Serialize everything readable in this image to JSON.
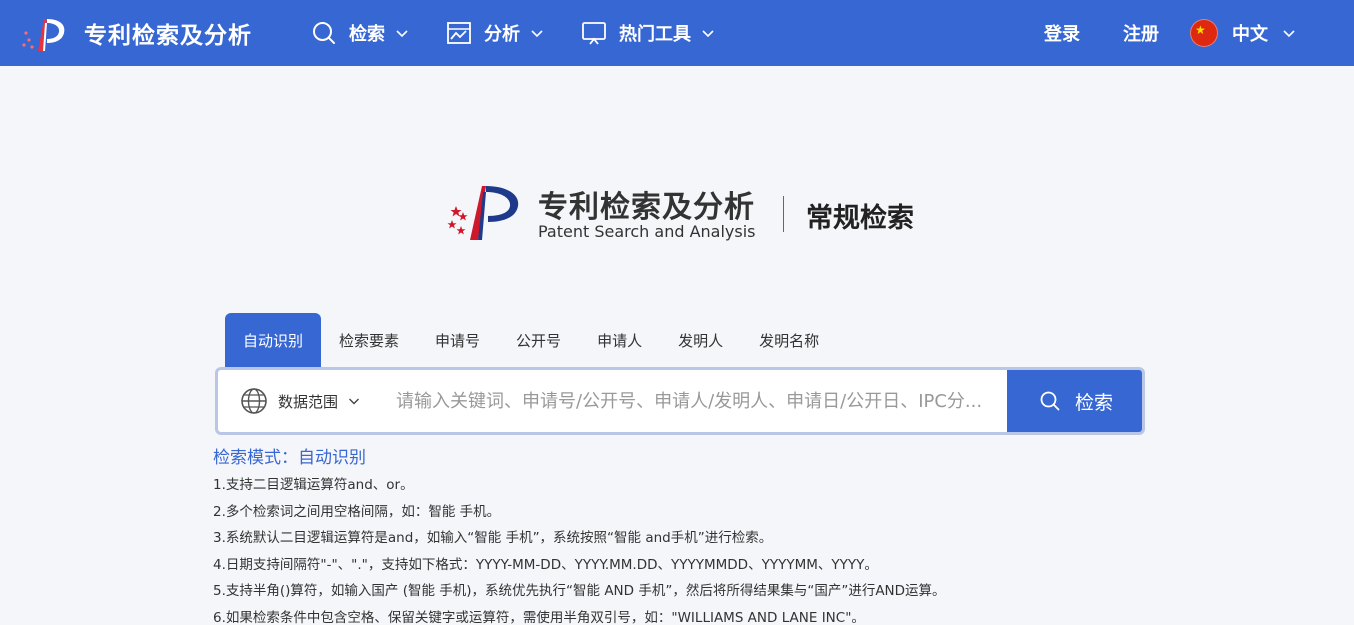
{
  "header": {
    "brand_title": "专利检索及分析",
    "nav": [
      {
        "label": "检索",
        "icon": "search-icon"
      },
      {
        "label": "分析",
        "icon": "chart-icon"
      },
      {
        "label": "热门工具",
        "icon": "monitor-icon"
      }
    ],
    "login": "登录",
    "register": "注册",
    "language": "中文"
  },
  "logo": {
    "title_cn": "专利检索及分析",
    "title_en": "Patent Search and Analysis",
    "subtitle": "常规检索"
  },
  "tabs": [
    {
      "label": "自动识别",
      "active": true
    },
    {
      "label": "检索要素",
      "active": false
    },
    {
      "label": "申请号",
      "active": false
    },
    {
      "label": "公开号",
      "active": false
    },
    {
      "label": "申请人",
      "active": false
    },
    {
      "label": "发明人",
      "active": false
    },
    {
      "label": "发明名称",
      "active": false
    }
  ],
  "search": {
    "scope_label": "数据范围",
    "placeholder": "请输入关键词、申请号/公开号、申请人/发明人、申请日/公开日、IPC分...",
    "button_label": "检索"
  },
  "mode_text": "检索模式：自动识别",
  "hints": [
    "1.支持二目逻辑运算符and、or。",
    "2.多个检索词之间用空格间隔，如：智能 手机。",
    "3.系统默认二目逻辑运算符是and，如输入“智能 手机”，系统按照“智能 and手机”进行检索。",
    "4.日期支持间隔符\"-\"、\".\"，支持如下格式：YYYY-MM-DD、YYYY.MM.DD、YYYYMMDD、YYYYMM、YYYY。",
    "5.支持半角()算符，如输入国产 (智能 手机)，系统优先执行“智能 AND 手机”，然后将所得结果集与“国产”进行AND运算。",
    "6.如果检索条件中包含空格、保留关键字或运算符，需使用半角双引号，如：\"WILLIAMS AND LANE INC\"。"
  ],
  "colors": {
    "primary": "#3767d2",
    "background": "#f5f6fa",
    "logo_red": "#d0182b",
    "logo_blue": "#1f3a8a"
  }
}
